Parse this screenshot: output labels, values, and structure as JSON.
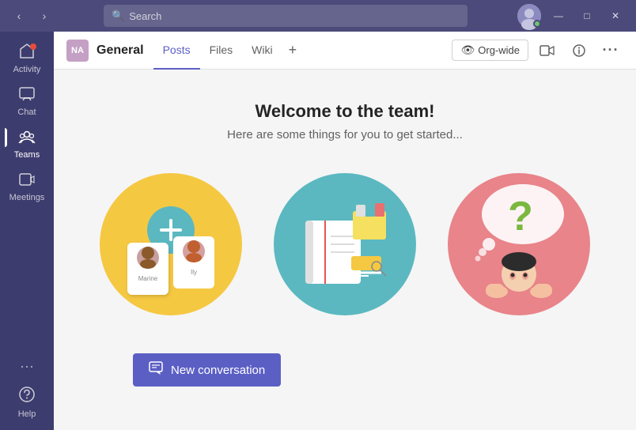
{
  "titlebar": {
    "search_placeholder": "Search",
    "minimize_label": "—",
    "maximize_label": "□",
    "close_label": "✕"
  },
  "sidebar": {
    "items": [
      {
        "id": "activity",
        "label": "Activity",
        "icon": "🔔"
      },
      {
        "id": "chat",
        "label": "Chat",
        "icon": "💬"
      },
      {
        "id": "teams",
        "label": "Teams",
        "icon": "👥"
      },
      {
        "id": "meetings",
        "label": "Meetings",
        "icon": "📅"
      }
    ],
    "more_icon": "•••",
    "help_label": "Help",
    "help_icon": "?"
  },
  "channel": {
    "avatar_initials": "NA",
    "name": "General",
    "tabs": [
      {
        "id": "posts",
        "label": "Posts",
        "active": true
      },
      {
        "id": "files",
        "label": "Files",
        "active": false
      },
      {
        "id": "wiki",
        "label": "Wiki",
        "active": false
      }
    ],
    "add_tab_title": "Add a tab",
    "org_wide_label": "Org-wide",
    "video_icon": "📹",
    "info_icon": "ℹ",
    "more_icon": "•••"
  },
  "main": {
    "welcome_title": "Welcome to the team!",
    "welcome_subtitle": "Here are some things for you to get started...",
    "new_conversation_label": "New conversation"
  },
  "colors": {
    "sidebar_bg": "#3d3c6e",
    "title_bar_bg": "#4b4a7a",
    "accent": "#5b5fc4",
    "yellow": "#f5c842",
    "teal": "#5bb8c0",
    "pink": "#e8848a"
  }
}
